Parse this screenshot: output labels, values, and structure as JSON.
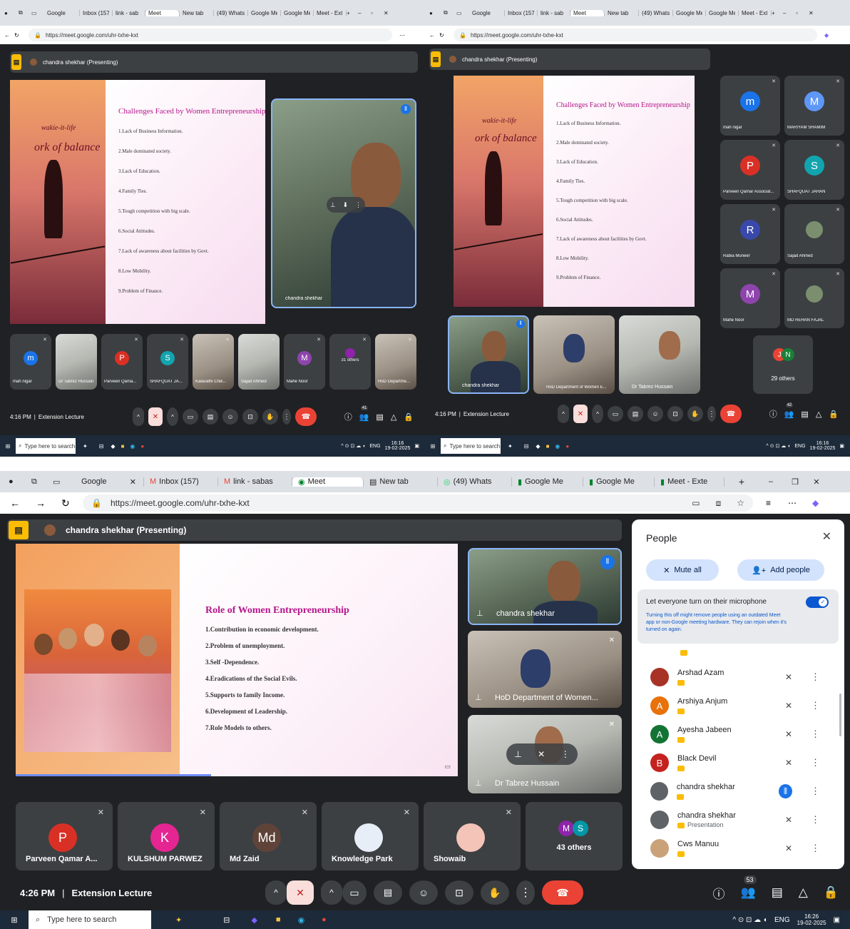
{
  "tabs": [
    "Google",
    "Inbox (157)",
    "link - sabas",
    "Meet",
    "New tab",
    "(49) Whats",
    "Google Me",
    "Google Me",
    "Meet - Exte"
  ],
  "tabs_small": [
    "Google",
    "Inbox (157)",
    "link - sab",
    "Meet",
    "New tab",
    "(49) Whats",
    "Google Me",
    "Google Me",
    "Meet - Ext"
  ],
  "url": "https://meet.google.com/uhr-txhe-kxt",
  "url2": "https://meet.google.com/uhr-txhe-kxt",
  "presenting": "chandra shekhar (Presenting)",
  "slide_a": {
    "art_text1": "wakie-it-life",
    "art_text2": "ork of balance",
    "title": "Challenges Faced by Women Entrepreneurship",
    "items": [
      "1.Lack of Business Information.",
      "2.Male dominated society.",
      "3.Lack of Education.",
      "4.Family Ties.",
      "5.Tough competition with big scale.",
      "6.Social Attitudes.",
      "7.Lack of awareness about facilities by Govt.",
      "8.Low Mobility.",
      "9.Problem of Finance."
    ]
  },
  "slide_b": {
    "title": "Role of Women Entrepreneurship",
    "items": [
      "1.Contribution in economic development.",
      "2.Problem of unemployment.",
      "3.Self -Dependence.",
      "4.Eradications of the Social Evils.",
      "5.Supports to family Income.",
      "6.Development of Leadership.",
      "7.Role Models to others."
    ]
  },
  "panel1": {
    "speaker": "chandra shekhar",
    "strip": [
      {
        "name": "mah nigar",
        "letter": "m",
        "color": "#1a73e8"
      },
      {
        "name": "Dr Tabrez Hussain",
        "letter": "",
        "color": ""
      },
      {
        "name": "Parveen Qama...",
        "letter": "P",
        "color": "#d93025"
      },
      {
        "name": "SHAFQUAT JA...",
        "letter": "S",
        "color": "#12a4af"
      },
      {
        "name": "Kalavathi Chik...",
        "letter": "",
        "color": ""
      },
      {
        "name": "Sajad Ahmed",
        "letter": "",
        "color": ""
      },
      {
        "name": "Mahe Noor",
        "letter": "M",
        "color": "#8e44ad"
      },
      {
        "name": "31 others",
        "letter": "",
        "color": ""
      },
      {
        "name": "HoD Departme...",
        "letter": "",
        "color": ""
      }
    ],
    "time": "4:16 PM",
    "meeting": "Extension Lecture",
    "people_count": "41",
    "clock": "16:16",
    "date": "19-02-2025"
  },
  "panel2": {
    "grid": [
      {
        "name": "mah nigar",
        "letter": "m",
        "color": "#1a73e8"
      },
      {
        "name": "MARIYAM SHAMIM",
        "letter": "M",
        "color": "#5e97f6"
      },
      {
        "name": "Parveen Qamar Associat...",
        "letter": "P",
        "color": "#d93025"
      },
      {
        "name": "SHAFQUAT JAHAN",
        "letter": "S",
        "color": "#12a4af"
      },
      {
        "name": "Rabia Muneer",
        "letter": "R",
        "color": "#3949ab"
      },
      {
        "name": "Sajad Ahmed",
        "letter": "",
        "color": ""
      },
      {
        "name": "Mahe Noor",
        "letter": "M",
        "color": "#8e44ad"
      },
      {
        "name": "MD REHAN FAJAL",
        "letter": "",
        "color": ""
      }
    ],
    "others": "29 others",
    "others_avatars": [
      "J",
      "N"
    ],
    "videos": [
      "chandra shekhar",
      "HoD Department of Women E...",
      "Dr Tabrez Hussain"
    ],
    "time": "4:16 PM",
    "meeting": "Extension Lecture",
    "people_count": "42",
    "clock": "16:16",
    "date": "19-02-2025"
  },
  "panel3": {
    "videos": [
      "chandra shekhar",
      "HoD Department of Women...",
      "Dr Tabrez Hussain"
    ],
    "strip": [
      {
        "name": "Parveen Qamar A...",
        "letter": "P",
        "color": "#d93025"
      },
      {
        "name": "KULSHUM PARWEZ",
        "letter": "K",
        "color": "#e52592"
      },
      {
        "name": "Md Zaid",
        "letter": "Md",
        "color": "#5f4339"
      },
      {
        "name": "Knowledge Park",
        "letter": "",
        "color": ""
      },
      {
        "name": "Showaib",
        "letter": "",
        "color": ""
      },
      {
        "name": "43 others",
        "letter": "",
        "color": ""
      }
    ],
    "others_avatars": [
      "M",
      "S"
    ],
    "time": "4:26 PM",
    "meeting": "Extension Lecture",
    "people_count": "53",
    "clock": "16:26",
    "date": "19-02-2025"
  },
  "people_panel": {
    "title": "People",
    "mute_all": "Mute all",
    "add_people": "Add people",
    "mic_toggle_label": "Let everyone turn on their microphone",
    "mic_toggle_on": true,
    "warning": "Turning this off might remove people using an outdated Meet app or non-Google meeting hardware. They can rejoin when it's turned on again.",
    "participants": [
      {
        "name": "Arshad Azam",
        "letter": "",
        "color": "#a93226",
        "sub": ""
      },
      {
        "name": "Arshiya Anjum",
        "letter": "A",
        "color": "#e8710a",
        "sub": ""
      },
      {
        "name": "Ayesha Jabeen",
        "letter": "A",
        "color": "#137333",
        "sub": ""
      },
      {
        "name": "Black Devil",
        "letter": "B",
        "color": "#c5221f",
        "sub": ""
      },
      {
        "name": "chandra shekhar",
        "letter": "",
        "color": "#5f6368",
        "sub": ""
      },
      {
        "name": "chandra shekhar",
        "letter": "",
        "color": "#5f6368",
        "sub": "Presentation"
      },
      {
        "name": "Cws Manuu",
        "letter": "",
        "color": "#c9a27a",
        "sub": ""
      }
    ]
  },
  "taskbar": {
    "search_placeholder": "Type here to search",
    "lang": "ENG"
  },
  "colors": {
    "meet_bg": "#202124",
    "tile": "#3c4043",
    "end_call": "#ea4335",
    "accent": "#1a73e8",
    "present_badge": "#fbbc04"
  }
}
